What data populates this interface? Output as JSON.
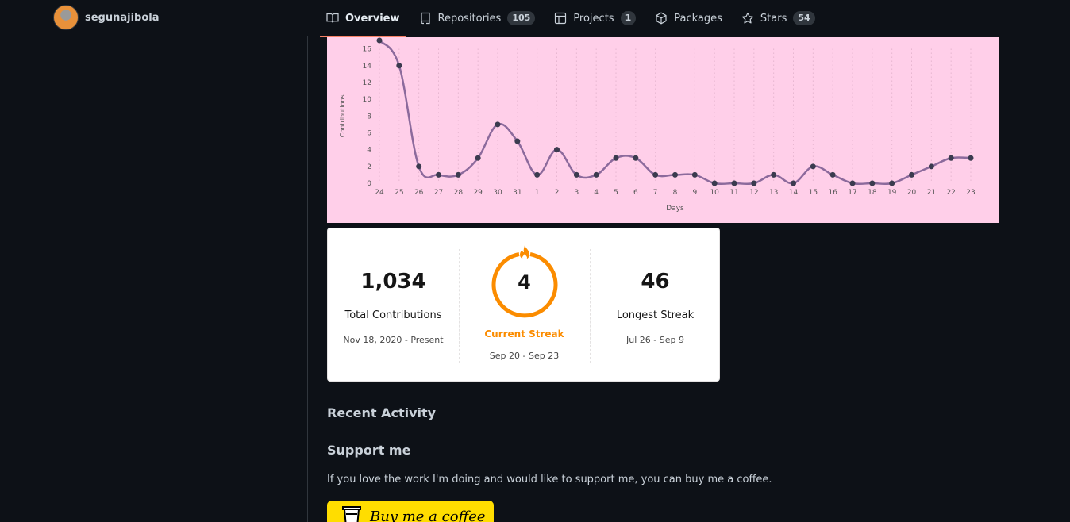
{
  "user": {
    "username": "segunajibola"
  },
  "tabs": [
    {
      "label": "Overview",
      "icon": "book-icon",
      "count": null,
      "active": true
    },
    {
      "label": "Repositories",
      "icon": "repo-icon",
      "count": "105",
      "active": false
    },
    {
      "label": "Projects",
      "icon": "project-icon",
      "count": "1",
      "active": false
    },
    {
      "label": "Packages",
      "icon": "package-icon",
      "count": null,
      "active": false
    },
    {
      "label": "Stars",
      "icon": "star-icon",
      "count": "54",
      "active": false
    }
  ],
  "chart_data": {
    "type": "line",
    "xlabel": "Days",
    "ylabel": "Contributions",
    "ylim": [
      0,
      17
    ],
    "yticks": [
      0,
      2,
      4,
      6,
      8,
      10,
      12,
      14,
      16
    ],
    "categories": [
      "24",
      "25",
      "26",
      "27",
      "28",
      "29",
      "30",
      "31",
      "1",
      "2",
      "3",
      "4",
      "5",
      "6",
      "7",
      "8",
      "9",
      "10",
      "11",
      "12",
      "13",
      "14",
      "15",
      "16",
      "17",
      "18",
      "19",
      "20",
      "21",
      "22",
      "23"
    ],
    "values": [
      17,
      14,
      2,
      1,
      1,
      3,
      7,
      5,
      1,
      4,
      1,
      1,
      3,
      3,
      1,
      1,
      1,
      0,
      0,
      0,
      1,
      0,
      2,
      1,
      0,
      0,
      0,
      1,
      2,
      3,
      3
    ],
    "grid": true,
    "colors": {
      "background": "#ffcfe9",
      "line": "#8c6a9c",
      "point": "#3b3b4f"
    }
  },
  "stats": {
    "total": {
      "value": "1,034",
      "label": "Total Contributions",
      "range": "Nov 18, 2020 - Present"
    },
    "current": {
      "value": "4",
      "label": "Current Streak",
      "range": "Sep 20 - Sep 23"
    },
    "longest": {
      "value": "46",
      "label": "Longest Streak",
      "range": "Jul 26 - Sep 9"
    }
  },
  "sections": {
    "recent_activity": "Recent Activity",
    "support_title": "Support me",
    "support_text": "If you love the work I'm doing and would like to support me, you can buy me a coffee.",
    "bmc_label": "Buy me a coffee"
  },
  "colors": {
    "accent": "#f78166",
    "streak": "#fb8c00",
    "bmc": "#ffdd00"
  }
}
